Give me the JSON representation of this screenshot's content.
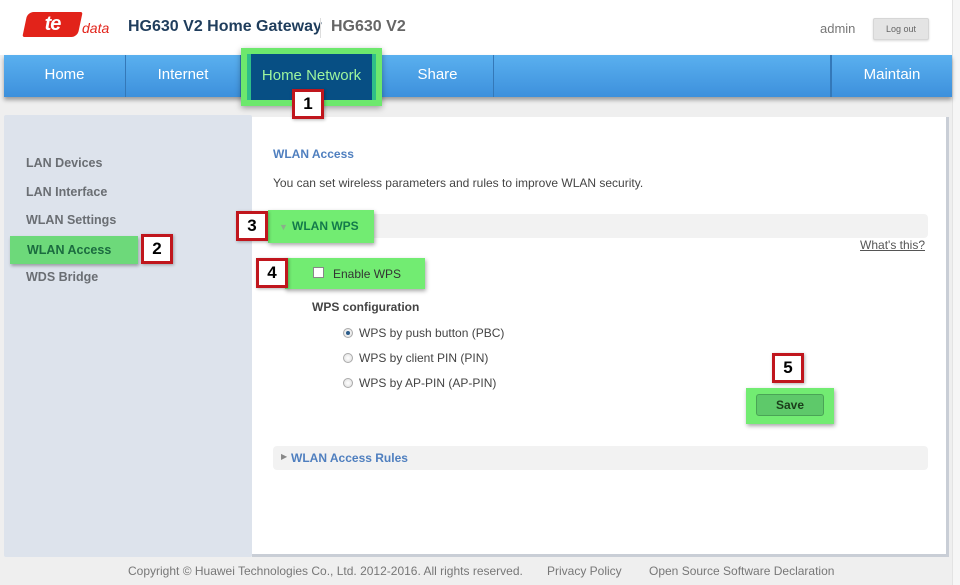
{
  "header": {
    "logo_text": "te",
    "logo_suffix": "data",
    "title": "HG630 V2 Home Gateway",
    "model": "HG630 V2",
    "user": "admin",
    "logout_label": "Log out"
  },
  "nav": {
    "items": [
      {
        "label": "Home"
      },
      {
        "label": "Internet"
      },
      {
        "label": "Home Network",
        "active": true
      },
      {
        "label": "Share"
      },
      {
        "label": ""
      },
      {
        "label": "Maintain"
      }
    ]
  },
  "sidebar": {
    "items": [
      {
        "label": "LAN Devices"
      },
      {
        "label": "LAN Interface"
      },
      {
        "label": "WLAN Settings"
      },
      {
        "label": "WLAN Access",
        "active": true
      },
      {
        "label": "WDS Bridge"
      }
    ]
  },
  "main": {
    "title": "WLAN Access",
    "description": "You can set wireless parameters and rules to improve WLAN security.",
    "wps_section": {
      "label": "WLAN WPS",
      "expanded": true,
      "whats_this": "What's this?",
      "enable_label": "Enable WPS",
      "enable_checked": false,
      "config_label": "WPS configuration",
      "options": [
        {
          "label": "WPS by push button (PBC)",
          "selected": true
        },
        {
          "label": "WPS by client PIN (PIN)",
          "selected": false
        },
        {
          "label": "WPS by AP-PIN (AP-PIN)",
          "selected": false
        }
      ],
      "save_label": "Save"
    },
    "rules_section": {
      "label": "WLAN Access Rules",
      "expanded": false
    }
  },
  "annotations": {
    "step1": "1",
    "step2": "2",
    "step3": "3",
    "step4": "4",
    "step5": "5",
    "highlight_color": "#72ec72",
    "badge_border_color": "#c0161d"
  },
  "footer": {
    "copyright": "Copyright © Huawei Technologies Co., Ltd. 2012-2016. All rights reserved.",
    "privacy": "Privacy Policy",
    "open_source": "Open Source Software Declaration"
  }
}
